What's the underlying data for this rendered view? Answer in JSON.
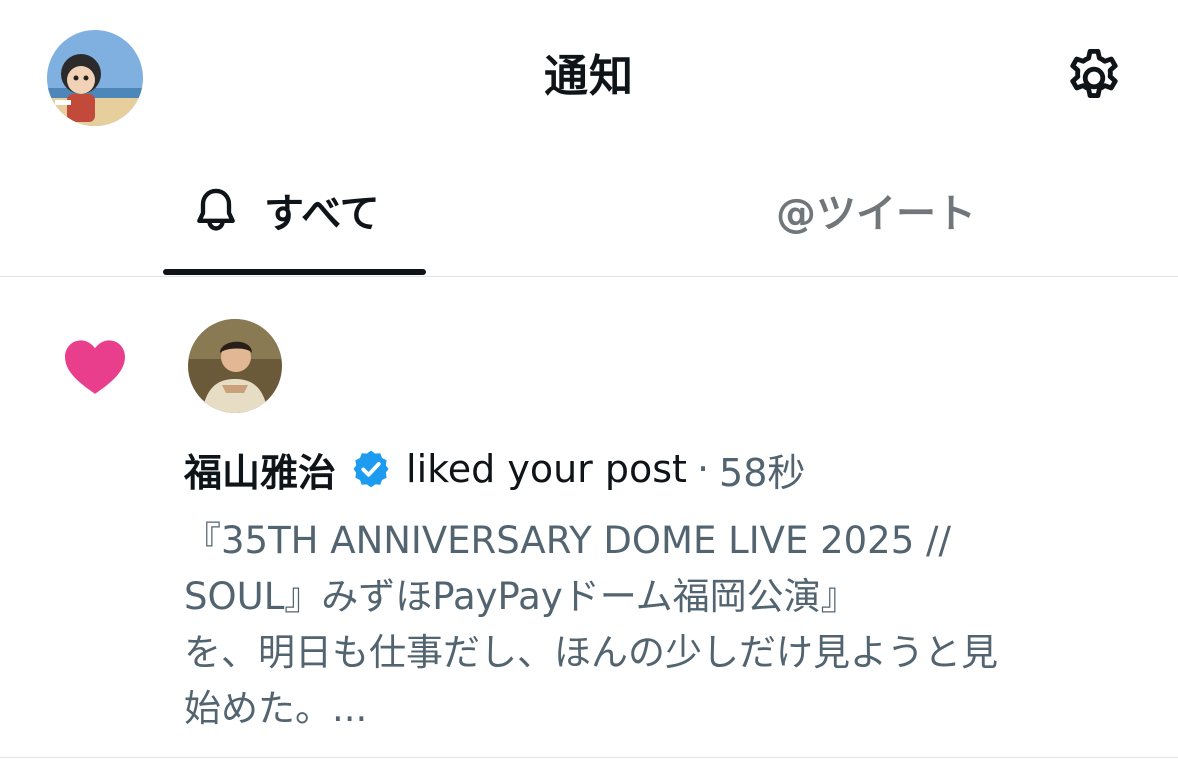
{
  "header": {
    "title": "通知",
    "avatar_icon": "user-avatar-icon",
    "settings_icon": "gear-icon"
  },
  "tabs": [
    {
      "label": "すべて",
      "icon": "bell-icon",
      "active": true
    },
    {
      "label": "@ツイート",
      "active": false
    }
  ],
  "notification": {
    "type_icon": "heart-icon",
    "actor_name": "福山雅治",
    "verified": true,
    "action": "liked your post",
    "separator": "·",
    "time": "58秒",
    "post_text": "『35TH ANNIVERSARY DOME LIVE 2025 //\nSOUL』みずほPayPayドーム福岡公演』\nを、明日も仕事だし、ほんの少しだけ見ようと見\n始めた。..."
  },
  "colors": {
    "text_primary": "#0f1419",
    "text_secondary": "#536471",
    "tab_inactive": "#71767b",
    "heart": "#e83e8c",
    "verified": "#1d9bf0",
    "divider": "#e1e4e7"
  }
}
